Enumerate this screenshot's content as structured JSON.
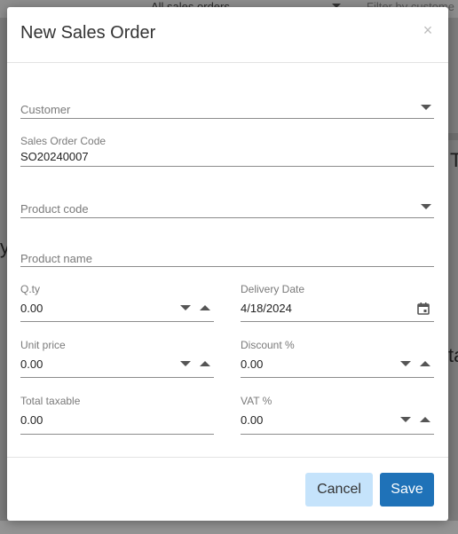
{
  "background": {
    "top_text_left": "All sales orders",
    "top_text_right": "Filter by custome",
    "glyph_t": "T",
    "glyph_y": "y",
    "glyph_ta": "ta"
  },
  "modal": {
    "title": "New Sales Order",
    "close_icon": "×"
  },
  "form": {
    "customer": {
      "label": "Customer",
      "value": ""
    },
    "sales_order_code": {
      "label": "Sales Order Code",
      "value": "SO20240007"
    },
    "product_code": {
      "label": "Product code",
      "value": ""
    },
    "product_name": {
      "label": "Product name",
      "value": ""
    },
    "qty": {
      "label": "Q.ty",
      "value": "0.00"
    },
    "delivery_date": {
      "label": "Delivery Date",
      "value": "4/18/2024"
    },
    "unit_price": {
      "label": "Unit price",
      "value": "0.00"
    },
    "discount": {
      "label": "Discount %",
      "value": "0.00"
    },
    "total_taxable": {
      "label": "Total taxable",
      "value": "0.00"
    },
    "vat": {
      "label": "VAT %",
      "value": "0.00"
    }
  },
  "footer": {
    "cancel_label": "Cancel",
    "save_label": "Save"
  },
  "colors": {
    "save": "#1f72b8",
    "cancel": "#c5e3fb"
  },
  "icons": {
    "dropdown": "chevron-down-icon",
    "spinner_down": "arrow-down-icon",
    "spinner_up": "arrow-up-icon",
    "calendar": "calendar-icon"
  }
}
